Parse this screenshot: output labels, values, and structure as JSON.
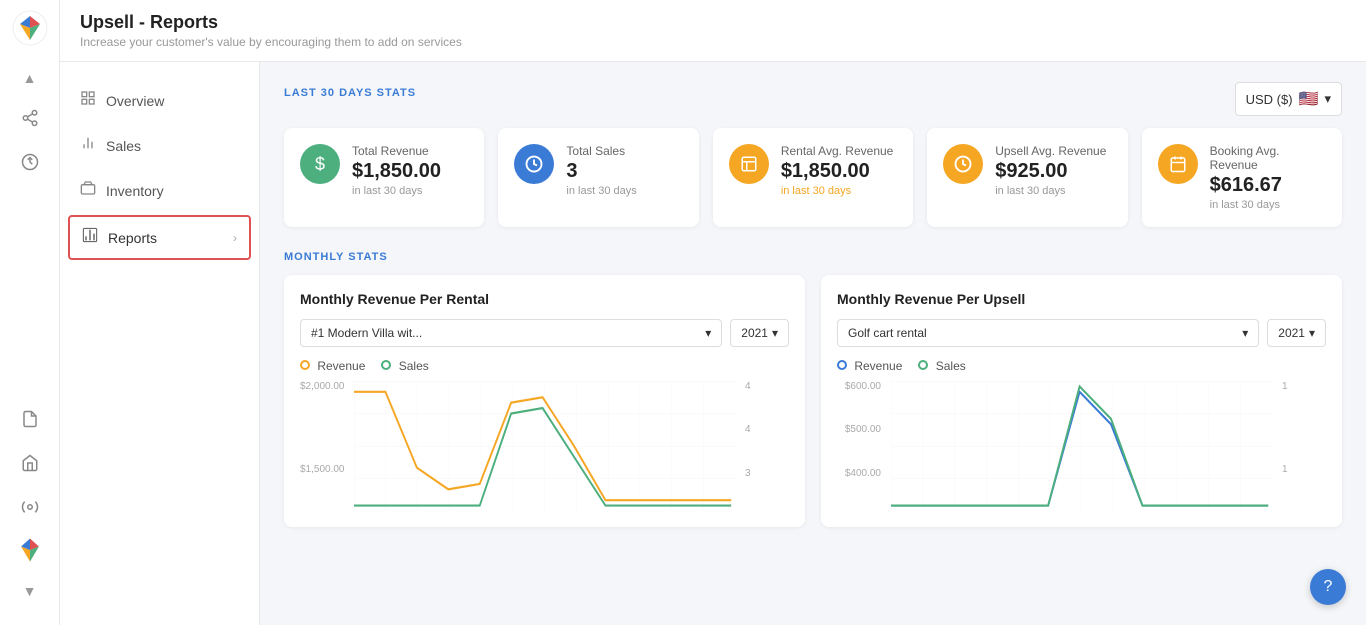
{
  "app": {
    "title": "Upsell - Reports",
    "subtitle": "Increase your customer's value by encouraging them to add on services"
  },
  "iconbar": {
    "chevron_up": "▲",
    "chevron_down": "▼",
    "icons": [
      {
        "name": "share-icon",
        "symbol": "⇢"
      },
      {
        "name": "bell-icon",
        "symbol": "🔔"
      },
      {
        "name": "document-icon",
        "symbol": "📄"
      },
      {
        "name": "store-icon",
        "symbol": "🏪"
      },
      {
        "name": "tool-icon",
        "symbol": "⚙"
      }
    ]
  },
  "sidebar": {
    "items": [
      {
        "id": "overview",
        "label": "Overview",
        "icon": "⊞",
        "active": false
      },
      {
        "id": "sales",
        "label": "Sales",
        "icon": "📊",
        "active": false
      },
      {
        "id": "inventory",
        "label": "Inventory",
        "icon": "🗃",
        "active": false
      },
      {
        "id": "reports",
        "label": "Reports",
        "icon": "📈",
        "active": true
      }
    ]
  },
  "stats_section": {
    "label": "LAST 30 DAYS STATS",
    "currency_label": "USD ($)",
    "cards": [
      {
        "id": "total-revenue",
        "icon": "$",
        "icon_color": "green",
        "label": "Total Revenue",
        "value": "$1,850.00",
        "sub": "in last 30 days",
        "sub_color": "normal"
      },
      {
        "id": "total-sales",
        "icon": "⏱",
        "icon_color": "blue",
        "label": "Total Sales",
        "value": "3",
        "sub": "in last 30 days",
        "sub_color": "normal"
      },
      {
        "id": "rental-avg",
        "icon": "🏠",
        "icon_color": "orange",
        "label": "Rental Avg. Revenue",
        "value": "$1,850.00",
        "sub": "in last 30 days",
        "sub_color": "orange"
      },
      {
        "id": "upsell-avg",
        "icon": "⏱",
        "icon_color": "orange",
        "label": "Upsell Avg. Revenue",
        "value": "$925.00",
        "sub": "in last 30 days",
        "sub_color": "normal"
      },
      {
        "id": "booking-avg",
        "icon": "📅",
        "icon_color": "orange",
        "label": "Booking Avg. Revenue",
        "value": "$616.67",
        "sub": "in last 30 days",
        "sub_color": "normal"
      }
    ]
  },
  "monthly_section": {
    "label": "MONTHLY STATS",
    "charts": [
      {
        "id": "rental-chart",
        "title": "Monthly Revenue Per Rental",
        "property_label": "#1 Modern Villa wit...",
        "year_label": "2021",
        "legend": [
          {
            "label": "Revenue",
            "color": "#f5a623"
          },
          {
            "label": "Sales",
            "color": "#4caf7d"
          }
        ],
        "y_labels": [
          "$2,000.00",
          "",
          "$1,500.00",
          ""
        ],
        "y_right_labels": [
          "4",
          "4",
          "3",
          ""
        ]
      },
      {
        "id": "upsell-chart",
        "title": "Monthly Revenue Per Upsell",
        "property_label": "Golf cart rental",
        "year_label": "2021",
        "legend": [
          {
            "label": "Revenue",
            "color": "#3a7bd5"
          },
          {
            "label": "Sales",
            "color": "#4caf7d"
          }
        ],
        "y_labels": [
          "$600.00",
          "$500.00",
          "$400.00",
          ""
        ],
        "y_right_labels": [
          "1",
          "",
          "1",
          ""
        ]
      }
    ]
  },
  "help_button_label": "?"
}
